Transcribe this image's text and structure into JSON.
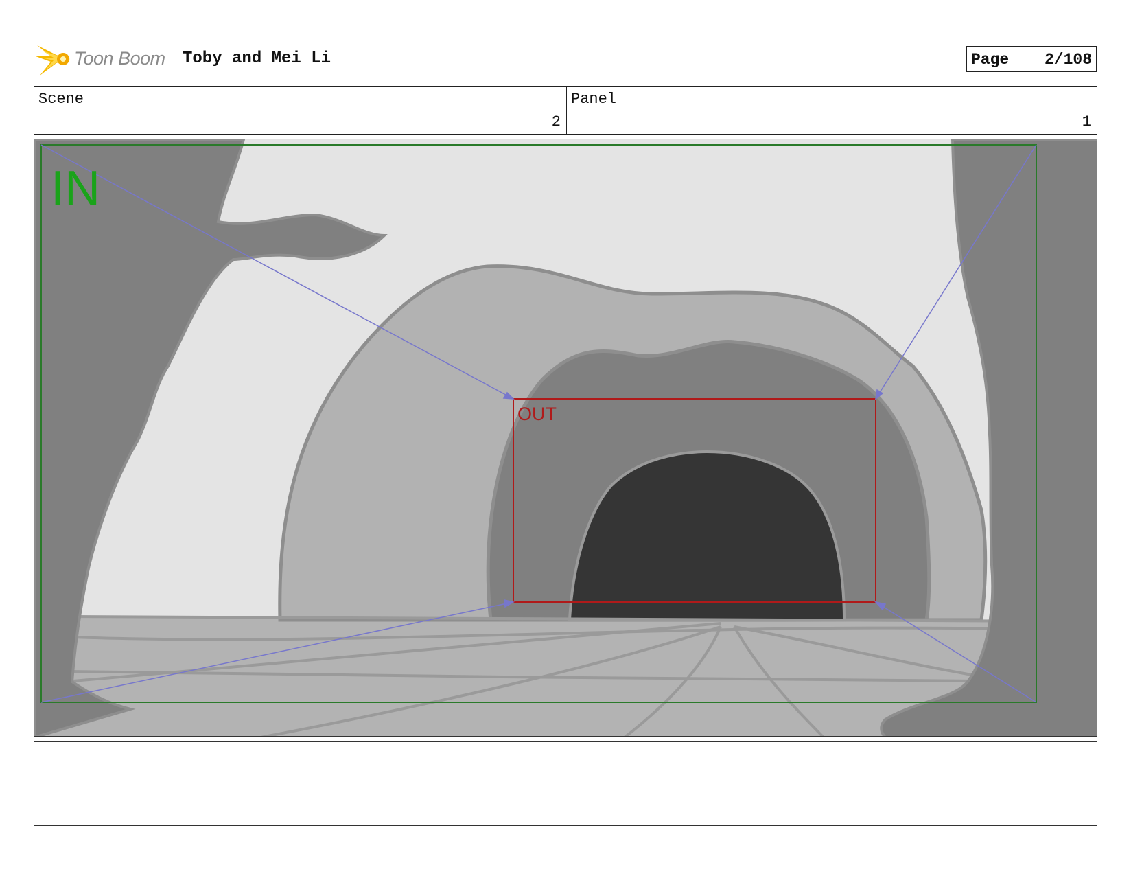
{
  "header": {
    "brand": "Toon Boom",
    "project_title": "Toby and Mei Li",
    "page_label": "Page",
    "page_value": "2/108"
  },
  "info": {
    "scene_label": "Scene",
    "scene_value": "2",
    "panel_label": "Panel",
    "panel_value": "1"
  },
  "frame": {
    "in_label": "IN",
    "out_label": "OUT",
    "in_color": "#1aa31a",
    "out_color": "#b01a1a",
    "camera_arrow_color": "#7777cc"
  },
  "caption": {
    "text": ""
  },
  "icons": {
    "logo": "toon-boom-burst-icon"
  }
}
